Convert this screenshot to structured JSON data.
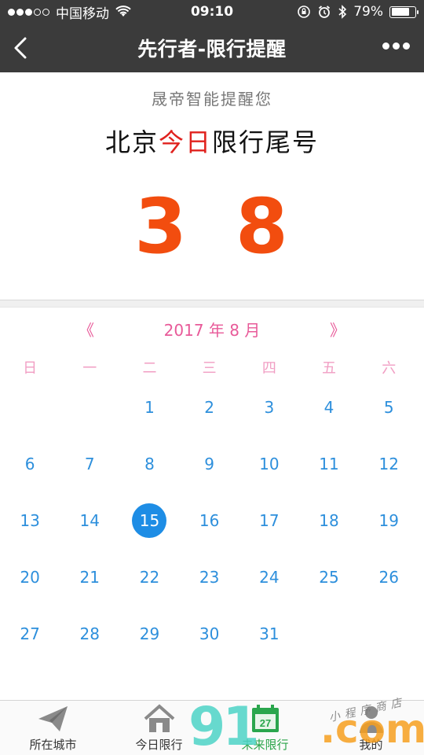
{
  "status_bar": {
    "carrier": "中国移动",
    "time": "09:10",
    "battery_percent": "79%",
    "battery_level": 0.79,
    "signal_strength_of_5": 3
  },
  "nav": {
    "title": "先行者-限行提醒",
    "back_icon": "chevron-left-icon",
    "more_icon": "more-dots-icon"
  },
  "header": {
    "subtitle": "晟帝智能提醒您",
    "city": "北京",
    "today": "今日",
    "suffix": "限行尾号",
    "digit1": "3",
    "digit2": "8",
    "highlight_color": "#e0221e",
    "number_color": "#f24d0f"
  },
  "calendar": {
    "prev_label": "《",
    "month_label": "2017 年 8 月",
    "next_label": "》",
    "weekdays": [
      "日",
      "一",
      "二",
      "三",
      "四",
      "五",
      "六"
    ],
    "weeks": [
      [
        "",
        "",
        "1",
        "2",
        "3",
        "4",
        "5"
      ],
      [
        "6",
        "7",
        "8",
        "9",
        "10",
        "11",
        "12"
      ],
      [
        "13",
        "14",
        "15",
        "16",
        "17",
        "18",
        "19"
      ],
      [
        "20",
        "21",
        "22",
        "23",
        "24",
        "25",
        "26"
      ],
      [
        "27",
        "28",
        "29",
        "30",
        "31",
        "",
        ""
      ]
    ],
    "selected_day": "15",
    "accent_color": "#1e8de5"
  },
  "tabs": [
    {
      "label": "所在城市",
      "icon": "paper-plane-icon"
    },
    {
      "label": "今日限行",
      "icon": "house-icon"
    },
    {
      "label": "未来限行",
      "icon": "calendar-icon",
      "badge": "27"
    },
    {
      "label": "我的",
      "icon": "user-icon"
    }
  ],
  "watermark": {
    "main": "91",
    "domain": ".com",
    "small": "小程序商店"
  }
}
